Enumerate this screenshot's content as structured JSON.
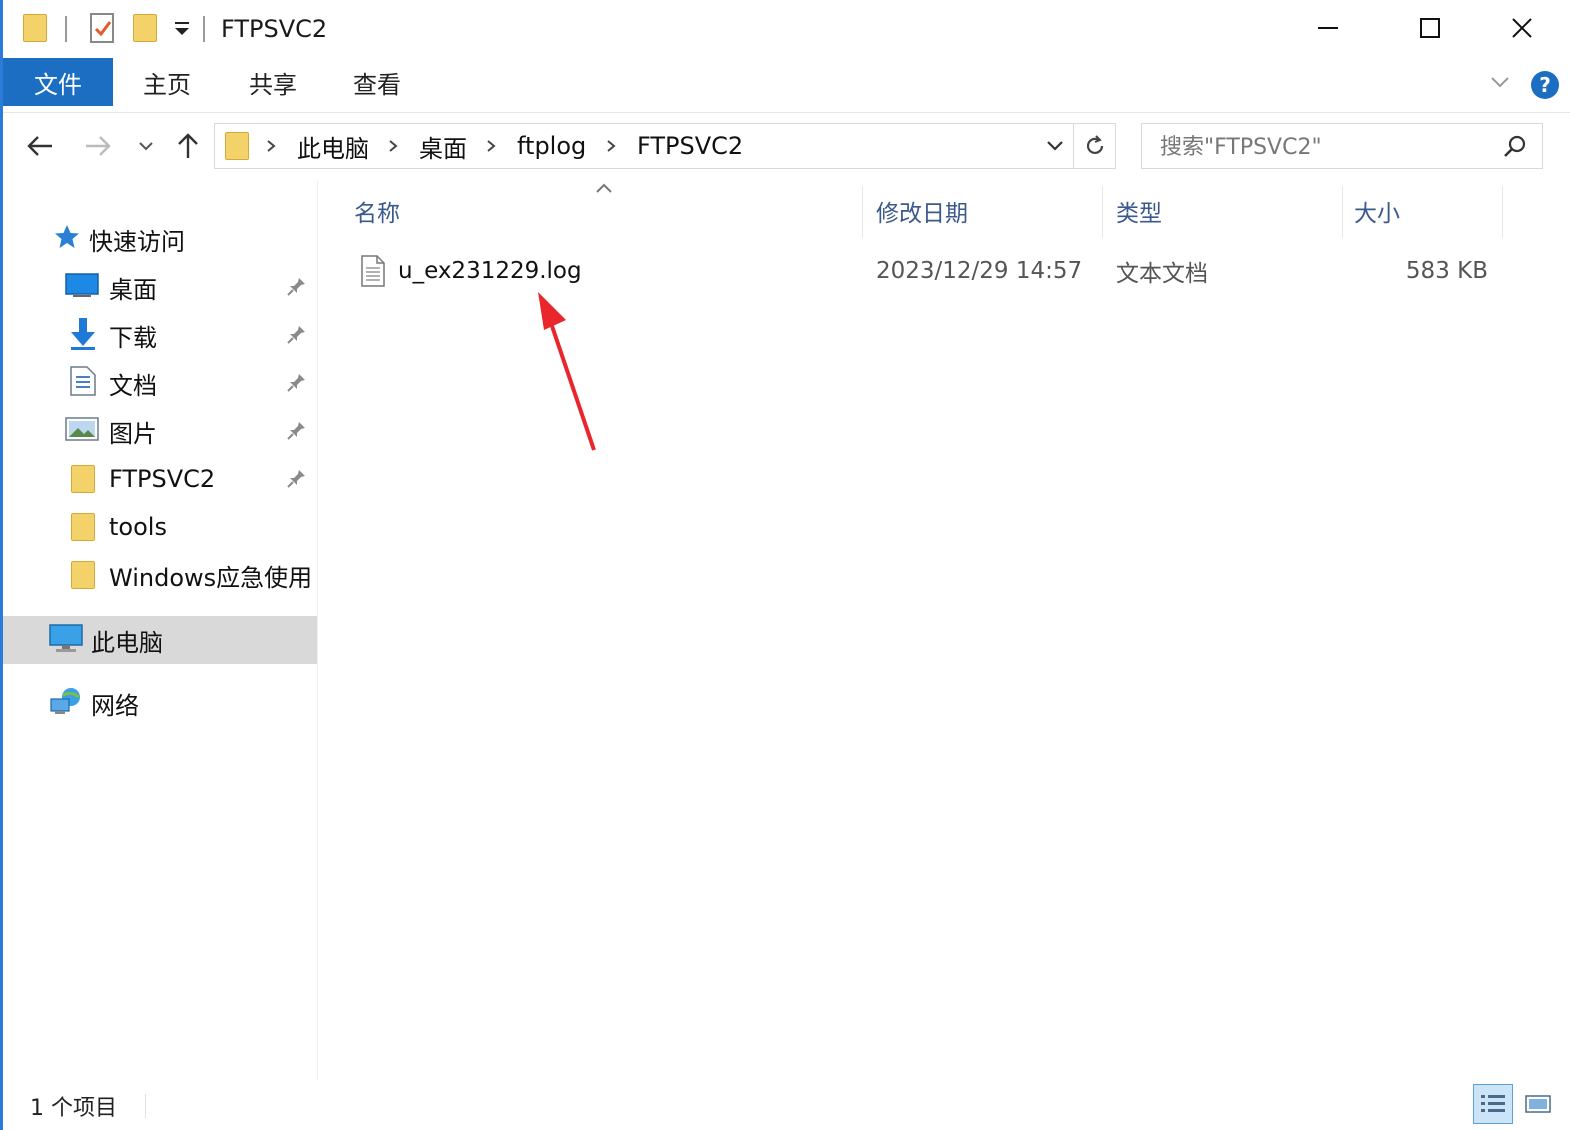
{
  "window": {
    "title": "FTPSVC2"
  },
  "ribbon": {
    "tabs": [
      {
        "label": "文件"
      },
      {
        "label": "主页"
      },
      {
        "label": "共享"
      },
      {
        "label": "查看"
      }
    ],
    "help_label": "?"
  },
  "address": {
    "breadcrumbs": [
      "此电脑",
      "桌面",
      "ftplog",
      "FTPSVC2"
    ]
  },
  "search": {
    "placeholder": "搜索\"FTPSVC2\""
  },
  "sidebar": {
    "quick_access_label": "快速访问",
    "items": [
      {
        "label": "桌面",
        "icon": "desktop-icon",
        "pinned": true
      },
      {
        "label": "下载",
        "icon": "download-icon",
        "pinned": true
      },
      {
        "label": "文档",
        "icon": "documents-icon",
        "pinned": true
      },
      {
        "label": "图片",
        "icon": "pictures-icon",
        "pinned": true
      },
      {
        "label": "FTPSVC2",
        "icon": "folder-icon",
        "pinned": true
      },
      {
        "label": "tools",
        "icon": "folder-icon",
        "pinned": false
      },
      {
        "label": "Windows应急使用",
        "icon": "folder-icon",
        "pinned": false
      }
    ],
    "this_pc_label": "此电脑",
    "network_label": "网络"
  },
  "columns": {
    "name": "名称",
    "modified": "修改日期",
    "type": "类型",
    "size": "大小"
  },
  "files": [
    {
      "name": "u_ex231229.log",
      "modified": "2023/12/29 14:57",
      "type": "文本文档",
      "size": "583 KB"
    }
  ],
  "status": {
    "item_count": "1 个项目"
  },
  "colors": {
    "accent": "#1b6ec2",
    "annotation_arrow": "#e8262b",
    "folder": "#f4d26a",
    "column_header_text": "#3b5a8c"
  }
}
